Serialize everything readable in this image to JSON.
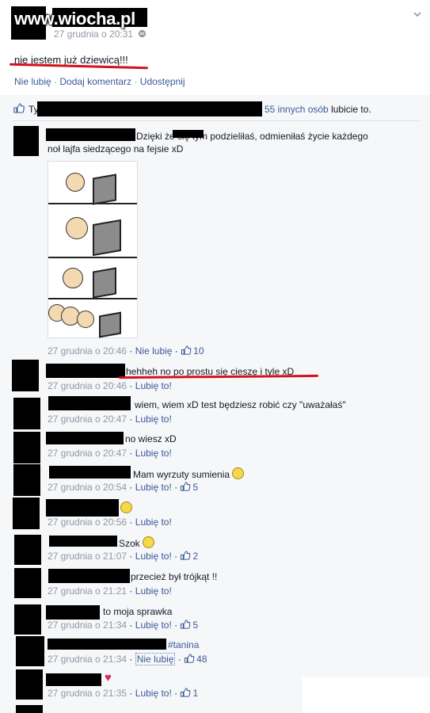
{
  "watermark": "www.wiocha.pl",
  "post": {
    "timestamp": "27 grudnia o 20:31",
    "text": "nie jestem już dziewicą!!!",
    "actions": [
      "Nie lubię",
      "Dodaj komentarz",
      "Udostępnij"
    ],
    "separator": "·",
    "likes_prefix": "Ty",
    "likes_others": "55 innych osób",
    "likes_suffix": "lubicie to."
  },
  "comments": [
    {
      "text": "Dzięki          że się tym podzieliłaś, odmieniłaś życie każdego",
      "text2": "noł lajfa siedzącego na fejsie xD",
      "time": "27 grudnia o 20:46",
      "action": "Nie lubię",
      "likes": "10"
    },
    {
      "text": "hehheh no po prostu się cieszę i tyle xD",
      "time": "27 grudnia o 20:46",
      "action": "Lubię to!",
      "likes": ""
    },
    {
      "text": "wiem, wiem xD test będziesz robić czy \"uważałaś\"",
      "time": "27 grudnia o 20:47",
      "action": "Lubię to!",
      "likes": ""
    },
    {
      "text": "no wiesz xD",
      "time": "27 grudnia o 20:47",
      "action": "Lubię to!",
      "likes": ""
    },
    {
      "text": "Mam wyrzuty sumienia",
      "time": "27 grudnia o 20:54",
      "action": "Lubię to!",
      "likes": "5"
    },
    {
      "text": "",
      "time": "27 grudnia o 20:56",
      "action": "Lubię to!",
      "likes": ""
    },
    {
      "text": "Szok",
      "time": "27 grudnia o 21:07",
      "action": "Lubię to!",
      "likes": "2"
    },
    {
      "text": "przecież był trójkąt !!",
      "time": "27 grudnia o 21:21",
      "action": "Lubię to!",
      "likes": ""
    },
    {
      "text": "to moja sprawka",
      "time": "27 grudnia o 21:34",
      "action": "Lubię to!",
      "likes": "5"
    },
    {
      "text": "#tanina",
      "time": "27 grudnia o 21:34",
      "action": "Nie lubię",
      "likes": "48"
    },
    {
      "text": "",
      "time": "27 grudnia o 21:35",
      "action": "Lubię to!",
      "likes": "1"
    }
  ],
  "colors": {
    "accent": "#3b5998",
    "underline": "#d3121b",
    "meta": "#9197a3"
  }
}
